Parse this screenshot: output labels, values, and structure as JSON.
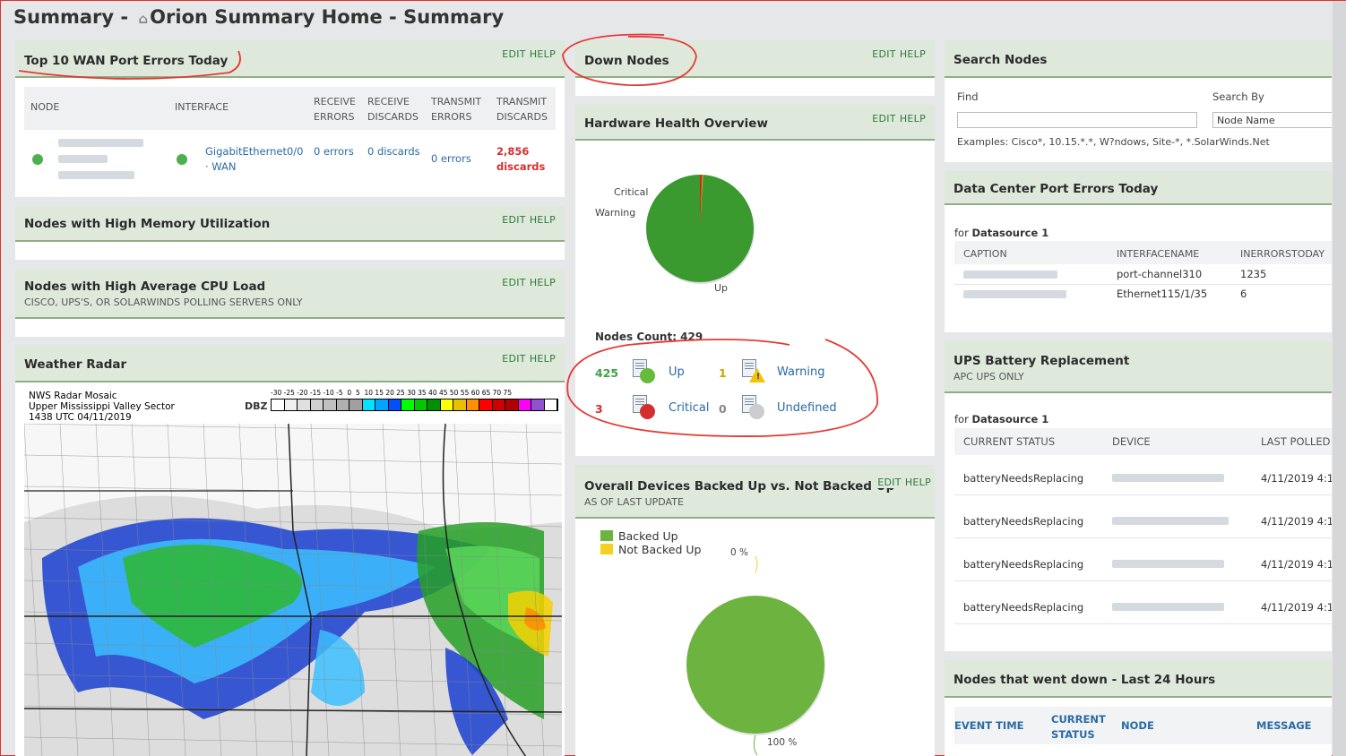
{
  "page": {
    "title_prefix": "Summary -",
    "title_main": "Orion Summary Home - Summary",
    "home_icon": "home-icon"
  },
  "common": {
    "edit": "EDIT",
    "help": "HELP"
  },
  "wan": {
    "title": "Top 10 WAN Port Errors Today",
    "headers": {
      "node": "NODE",
      "interface": "INTERFACE",
      "recv_errors": "RECEIVE ERRORS",
      "recv_discards": "RECEIVE DISCARDS",
      "tx_errors": "TRANSMIT ERRORS",
      "tx_discards": "TRANSMIT DISCARDS"
    },
    "row": {
      "interface": "GigabitEthernet0/0 · WAN",
      "recv_errors": "0 errors",
      "recv_discards": "0 discards",
      "tx_errors": "0 errors",
      "tx_discards": "2,856 discards"
    }
  },
  "mem": {
    "title": "Nodes with High Memory Utilization"
  },
  "cpu": {
    "title": "Nodes with High Average CPU Load",
    "subtitle": "CISCO, UPS'S, OR SOLARWINDS POLLING SERVERS ONLY"
  },
  "radar": {
    "title": "Weather Radar",
    "line1": "NWS Radar Mosaic",
    "line2": "Upper Mississippi Valley Sector",
    "line3": "1438 UTC 04/11/2019",
    "dbz": "DBZ",
    "scale_labels": "-30 -25 -20 -15 -10 -5  0  5  10 15 20 25 30 35 40 45 50 55 60 65 70 75",
    "scale_colors": [
      "#ffffff",
      "#f0f0f0",
      "#e0e0e0",
      "#d0d0d0",
      "#c0c0c0",
      "#b0b0b0",
      "#a0a0a0",
      "#00e5ff",
      "#00a5ff",
      "#0050ff",
      "#00ff00",
      "#00c800",
      "#009000",
      "#ffff00",
      "#e8c000",
      "#ff9000",
      "#ff0000",
      "#d00000",
      "#b00000",
      "#ff00ff",
      "#9050d0",
      "#ffffff"
    ]
  },
  "down": {
    "title": "Down Nodes"
  },
  "hw": {
    "title": "Hardware Health Overview",
    "pie_labels": {
      "critical": "Critical",
      "warning": "Warning",
      "up": "Up"
    },
    "nodes_count": "Nodes Count: 429",
    "stats": [
      {
        "count": "425",
        "label": "Up",
        "color": "#43a047",
        "dot": "#66bb3a"
      },
      {
        "count": "1",
        "label": "Warning",
        "color": "#c8a800",
        "dot": "#f5c400"
      },
      {
        "count": "3",
        "label": "Critical",
        "color": "#d32f2f",
        "dot": "#d32f2f"
      },
      {
        "count": "0",
        "label": "Undefined",
        "color": "#888888",
        "dot": "#cccccc"
      }
    ],
    "colors": {
      "up": "#3a9a30",
      "critical": "#c62828",
      "warning": "#f5c400"
    }
  },
  "backup": {
    "title": "Overall Devices Backed Up vs. Not Backed Up",
    "subtitle": "AS OF LAST UPDATE",
    "legend": [
      {
        "label": "Backed Up",
        "color": "#6db33f"
      },
      {
        "label": "Not Backed Up",
        "color": "#f5d020"
      }
    ],
    "pct_top": "0 %",
    "pct_bottom": "100 %"
  },
  "search": {
    "title": "Search Nodes",
    "find_label": "Find",
    "find_value": "",
    "search_by_label": "Search By",
    "search_by_value": "Node Name",
    "examples": "Examples: Cisco*, 10.15.*.*, W?ndows, Site-*, *.SolarWinds.Net"
  },
  "dc": {
    "title": "Data Center Port Errors Today",
    "for_text": "for",
    "datasource": "Datasource 1",
    "headers": {
      "caption": "CAPTION",
      "ifname": "INTERFACENAME",
      "inerr": "INERRORSTODAY"
    },
    "rows": [
      {
        "ifname": "port-channel310",
        "inerr": "1235"
      },
      {
        "ifname": "Ethernet115/1/35",
        "inerr": "6"
      }
    ]
  },
  "ups": {
    "title": "UPS Battery Replacement",
    "subtitle": "APC UPS ONLY",
    "for_text": "for",
    "datasource": "Datasource 1",
    "headers": {
      "status": "CURRENT STATUS",
      "device": "DEVICE",
      "last": "LAST POLLED"
    },
    "rows": [
      {
        "status": "batteryNeedsReplacing",
        "last": "4/11/2019 4:1"
      },
      {
        "status": "batteryNeedsReplacing",
        "last": "4/11/2019 4:1"
      },
      {
        "status": "batteryNeedsReplacing",
        "last": "4/11/2019 4:1"
      },
      {
        "status": "batteryNeedsReplacing",
        "last": "4/11/2019 4:1"
      }
    ]
  },
  "down24": {
    "title": "Nodes that went down - Last 24 Hours",
    "headers": {
      "event": "EVENT TIME",
      "status": "CURRENT STATUS",
      "node": "NODE",
      "message": "MESSAGE"
    }
  }
}
